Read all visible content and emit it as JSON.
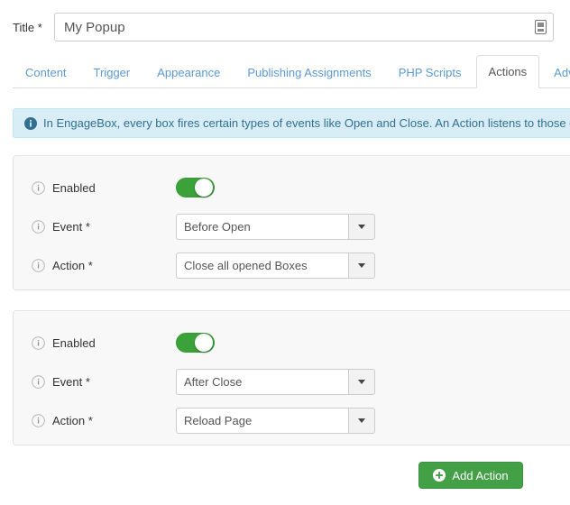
{
  "title_field": {
    "label": "Title",
    "required_mark": "*",
    "value": "My Popup",
    "placeholder": "Title",
    "addon_icon": "document-save-icon"
  },
  "tabs": [
    {
      "label": "Content",
      "active": false
    },
    {
      "label": "Trigger",
      "active": false
    },
    {
      "label": "Appearance",
      "active": false
    },
    {
      "label": "Publishing Assignments",
      "active": false
    },
    {
      "label": "PHP Scripts",
      "active": false
    },
    {
      "label": "Actions",
      "active": true
    },
    {
      "label": "Advanced",
      "active": false
    }
  ],
  "alert": {
    "icon": "info-circle-icon",
    "text": "In EngageBox, every box fires certain types of events like Open and Close. An Action listens to those e"
  },
  "panels": [
    {
      "enabled_label": "Enabled",
      "enabled_state": "on",
      "event_label": "Event *",
      "event_value": "Before Open",
      "action_label": "Action *",
      "action_value": "Close all opened Boxes"
    },
    {
      "enabled_label": "Enabled",
      "enabled_state": "on",
      "event_label": "Event *",
      "event_value": "After Close",
      "action_label": "Action *",
      "action_value": "Reload Page"
    }
  ],
  "add_action_button": {
    "label": "Add Action",
    "icon": "plus-circle-icon"
  },
  "colors": {
    "tab_link": "#5b9ad4",
    "alert_bg": "#d9edf7",
    "alert_border": "#bce8f1",
    "alert_text": "#31708f",
    "toggle_on": "#3ba23a",
    "button_green": "#43a047",
    "panel_bg": "#f8f8f8",
    "panel_border": "#e3e3e3"
  }
}
